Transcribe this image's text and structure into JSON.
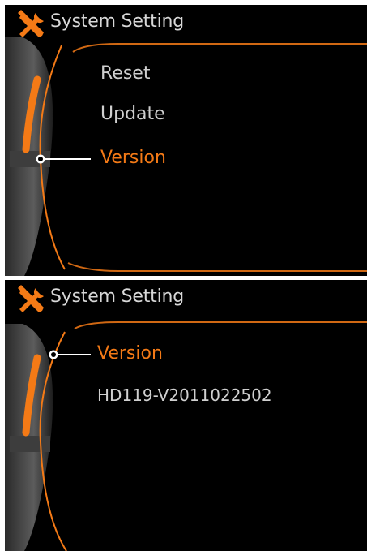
{
  "colors": {
    "accent": "#f47a16",
    "text": "#d0d0d0",
    "background": "#000000"
  },
  "screen_top": {
    "header": {
      "icon": "wrench-screwdriver-icon",
      "title": "System Setting"
    },
    "menu": {
      "items": [
        {
          "label": "Reset",
          "selected": false
        },
        {
          "label": "Update",
          "selected": false
        },
        {
          "label": "Version",
          "selected": true
        }
      ]
    }
  },
  "screen_bottom": {
    "header": {
      "icon": "wrench-screwdriver-icon",
      "title": "System Setting"
    },
    "selected_item": "Version",
    "version_value": "HD119-V2011022502"
  }
}
